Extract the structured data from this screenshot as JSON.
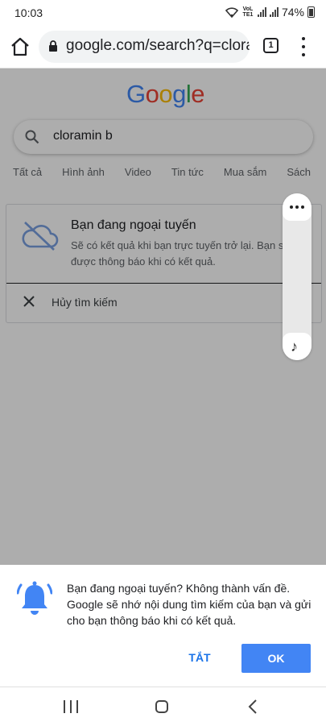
{
  "status_bar": {
    "time": "10:03",
    "network_label": "VoLTE1",
    "battery": "74%"
  },
  "browser": {
    "url": "google.com/search?q=cloramin",
    "tab_count": "1"
  },
  "search": {
    "logo_letters": [
      "G",
      "o",
      "o",
      "g",
      "l",
      "e"
    ],
    "logo_colors": [
      "#4285f4",
      "#ea4335",
      "#fbbc05",
      "#4285f4",
      "#34a853",
      "#ea4335"
    ],
    "query": "cloramin b",
    "tabs": [
      "Tất cả",
      "Hình ảnh",
      "Video",
      "Tin tức",
      "Mua sắm",
      "Sách"
    ]
  },
  "offline_card": {
    "title": "Bạn đang ngoại tuyến",
    "description_line1": "Sẽ có kết quả khi bạn trực tuyến trở lại. Bạn sẽ",
    "description_line2": "được thông báo khi có kết quả.",
    "cancel_label": "Hủy tìm kiếm"
  },
  "bottom_sheet": {
    "message": "Bạn đang ngoại tuyến? Không thành vấn đề. Google sẽ nhớ nội dung tìm kiếm của bạn và gửi cho bạn thông báo khi có kết quả.",
    "dismiss_label": "TẮT",
    "ok_label": "OK"
  },
  "colors": {
    "accent": "#1a73e8",
    "ok_button": "#4285f4",
    "scrim": "rgba(0,0,0,0.32)"
  },
  "icons": {
    "status": [
      "wifi-icon",
      "volte-icon",
      "signal-icon",
      "battery-icon"
    ],
    "toolbar": [
      "home-icon",
      "lock-icon",
      "tabs-icon",
      "more-vert-icon"
    ],
    "content": [
      "search-icon",
      "cloud-off-icon",
      "close-icon",
      "more-horiz-icon",
      "music-note-icon",
      "bell-icon"
    ],
    "nav": [
      "recent-apps-icon",
      "home-nav-icon",
      "back-icon"
    ]
  }
}
